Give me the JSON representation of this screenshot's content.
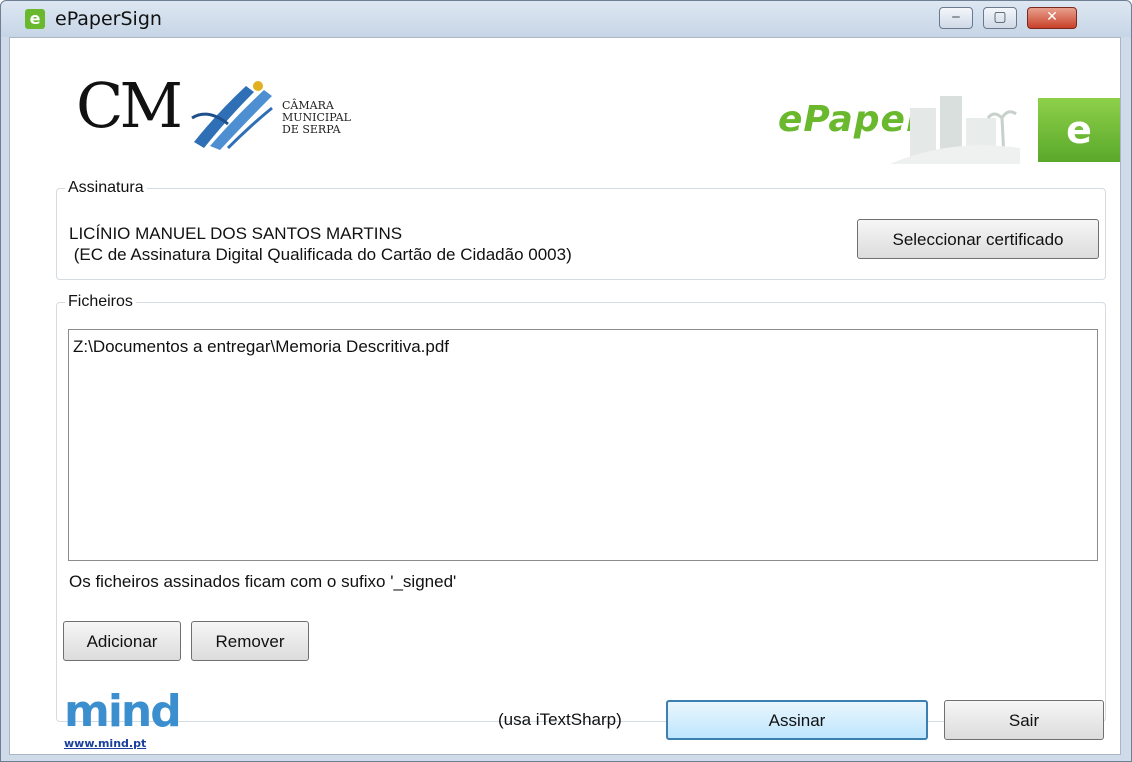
{
  "window": {
    "title": "ePaperSign",
    "app_icon_glyph": "e",
    "controls": {
      "minimize": "‒",
      "maximize": "▢",
      "close": "✕"
    }
  },
  "header": {
    "cm_logo_letters": "CM",
    "cm_name_lines": [
      "CÂMARA",
      "MUNICIPAL",
      "DE SERPA"
    ],
    "epaper_word": "ePaper",
    "epaper_badge_glyph": "e"
  },
  "signature": {
    "group_label": "Assinatura",
    "signer_name": "LICÍNIO MANUEL DOS SANTOS MARTINS",
    "signer_issuer": " (EC de Assinatura Digital Qualificada do Cartão de Cidadão 0003)",
    "select_cert_label": "Seleccionar certificado"
  },
  "files": {
    "group_label": "Ficheiros",
    "items": [
      "Z:\\Documentos a entregar\\Memoria Descritiva.pdf"
    ],
    "suffix_note": "Os ficheiros assinados ficam com o sufixo '_signed'",
    "add_label": "Adicionar",
    "remove_label": "Remover"
  },
  "footer": {
    "mind_logo": "mind",
    "mind_url": "www.mind.pt",
    "note": "(usa iTextSharp)",
    "sign_label": "Assinar",
    "exit_label": "Sair"
  },
  "colors": {
    "brand_green": "#6ab82e",
    "mind_blue": "#3b8fce",
    "close_red": "#c8412a",
    "default_button_border": "#3c7fb1"
  }
}
